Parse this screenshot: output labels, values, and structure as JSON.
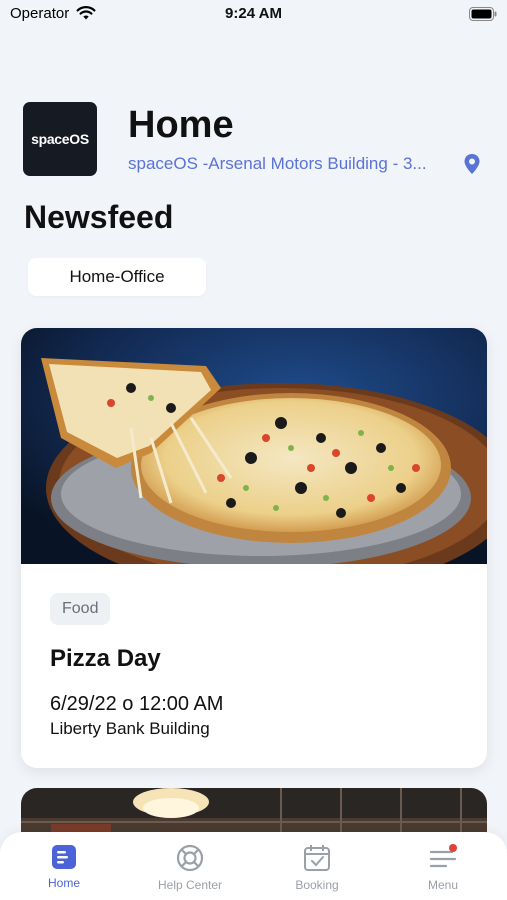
{
  "status_bar": {
    "carrier": "Operator",
    "time": "9:24 AM"
  },
  "header": {
    "logo_text": "spaceOS",
    "title": "Home",
    "location": "spaceOS -Arsenal Motors Building - 3...",
    "section_title": "Newsfeed"
  },
  "filter": {
    "selected": "Home-Office"
  },
  "card": {
    "category": "Food",
    "title": "Pizza Day",
    "datetime": "6/29/22 o 12:00 AM",
    "location": "Liberty Bank Building"
  },
  "tabs": [
    {
      "label": "Home",
      "icon": "home-feed-icon",
      "active": true
    },
    {
      "label": "Help Center",
      "icon": "lifebuoy-icon",
      "active": false
    },
    {
      "label": "Booking",
      "icon": "calendar-check-icon",
      "active": false
    },
    {
      "label": "Menu",
      "icon": "menu-icon",
      "active": false,
      "badge": true
    }
  ],
  "colors": {
    "accent": "#4b63d6",
    "location_text": "#5a73d6",
    "badge_dot": "#e0413b",
    "background": "#f1f4f8"
  }
}
